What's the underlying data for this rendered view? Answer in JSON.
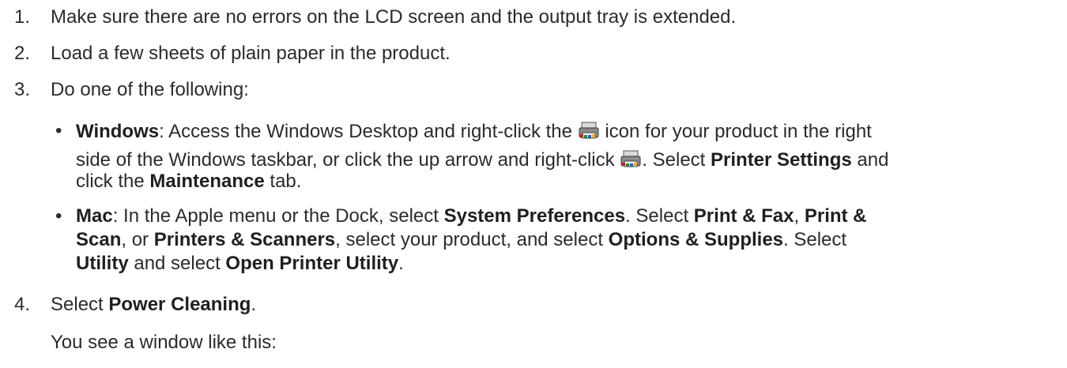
{
  "steps": [
    {
      "num": "1.",
      "text": "Make sure there are no errors on the LCD screen and the output tray is extended."
    },
    {
      "num": "2.",
      "text": "Load a few sheets of plain paper in the product."
    },
    {
      "num": "3.",
      "text": "Do one of the following:"
    },
    {
      "num": "4.",
      "text_before": "Select ",
      "bold": "Power Cleaning",
      "text_after": "."
    }
  ],
  "windows_item": {
    "bullet": "•",
    "label": "Windows",
    "l1_a": ": Access the Windows Desktop and right-click the ",
    "l1_b": " icon for your product in the right",
    "l2_a": "side of the Windows taskbar, or click the up arrow and right-click ",
    "l2_b": ". Select ",
    "printer_settings": "Printer Settings",
    "l2_c": " and",
    "l3_a": "click the ",
    "maintenance": "Maintenance",
    "l3_b": " tab."
  },
  "mac_item": {
    "bullet": "•",
    "label": "Mac",
    "l1_a": ": In the Apple menu or the Dock, select ",
    "system_prefs": "System Preferences",
    "l1_b": ". Select ",
    "print_fax": "Print & Fax",
    "l1_c": ", ",
    "print_amp": "Print &",
    "scan": "Scan",
    "l2_a": ", or ",
    "printers_scanners": "Printers & Scanners",
    "l2_b": ", select your product, and select ",
    "options_supplies": "Options & Supplies",
    "l2_c": ". Select",
    "utility": "Utility",
    "l3_a": " and select ",
    "open_printer_utility": "Open Printer Utility",
    "l3_b": "."
  },
  "after_step4": "You see a window like this:",
  "icons": {
    "taskbar_icon": "printer-taskbar-icon"
  }
}
